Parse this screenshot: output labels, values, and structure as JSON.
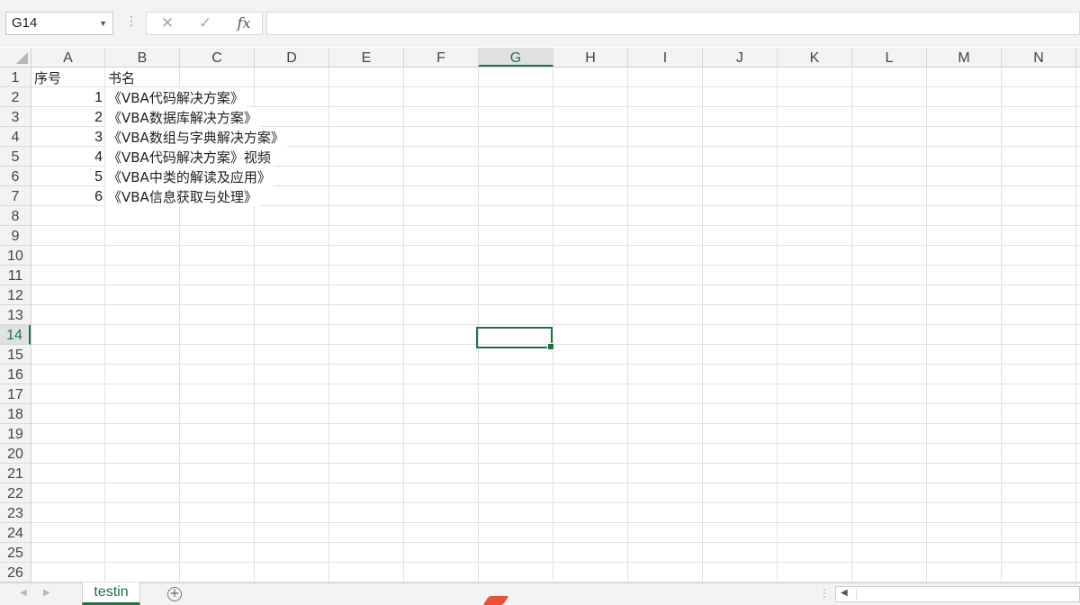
{
  "formula_bar": {
    "name_box": "G14",
    "cancel_icon": "✕",
    "enter_icon": "✓",
    "fx_label": "fx",
    "formula_value": ""
  },
  "columns": [
    "A",
    "B",
    "C",
    "D",
    "E",
    "F",
    "G",
    "H",
    "I",
    "J",
    "K",
    "L",
    "M",
    "N"
  ],
  "active_column": "G",
  "rows": [
    "1",
    "2",
    "3",
    "4",
    "5",
    "6",
    "7",
    "8",
    "9",
    "10",
    "11",
    "12",
    "13",
    "14",
    "15",
    "16",
    "17",
    "18",
    "19",
    "20",
    "21",
    "22",
    "23",
    "24",
    "25",
    "26"
  ],
  "active_row": "14",
  "cells": {
    "header_a": "序号",
    "header_b": "书名",
    "data": [
      {
        "num": "1",
        "title": "《VBA代码解决方案》"
      },
      {
        "num": "2",
        "title": "《VBA数据库解决方案》"
      },
      {
        "num": "3",
        "title": "《VBA数组与字典解决方案》"
      },
      {
        "num": "4",
        "title": "《VBA代码解决方案》视频"
      },
      {
        "num": "5",
        "title": "《VBA中类的解读及应用》"
      },
      {
        "num": "6",
        "title": "《VBA信息获取与处理》"
      }
    ]
  },
  "sheet_tabs": [
    "testin"
  ],
  "icons": {
    "name_box_dropdown": "chevron-down-icon",
    "cancel": "close-icon",
    "enter": "check-icon",
    "function": "fx-icon",
    "add_sheet": "plus-circle-icon",
    "prev_sheet": "triangle-left-icon",
    "next_sheet": "triangle-right-icon"
  },
  "colors": {
    "accent": "#217346",
    "header_bg": "#f3f3f3",
    "gridline": "#e1e1e1"
  }
}
